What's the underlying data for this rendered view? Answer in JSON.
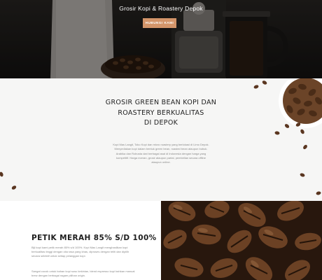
{
  "hero": {
    "title": "Grosir Kopi & Roastery Depok",
    "button_label": "HUBUNGI KAMI"
  },
  "intro": {
    "heading_lines": [
      "GROSIR GREEN BEAN KOPI DAN",
      "ROASTERY BERKUALITAS",
      "DI DEPOK"
    ],
    "body": "Kopi Mas Langit, Toko Kopi dan micro roastery yang berlokasi di Limo Depok. Menyediakan kopi dalam bentuk green bean, roasted bean ataupun bubuk. Arabika dan Robusta dari berbagai asal di Indonesia dengan harga yang kompetitif. Harga eceran, grosir ataupun partai, pembelian secara offline ataupun online."
  },
  "product": {
    "title": "PETIK MERAH 85% S/D 100%",
    "paragraph1": "Biji kopi kami petik merah 85% s/d 100%. Kopi Mas Langit menghasilkan kopi berkualitas tinggi dengan cita rasa yang khas, diproses dengan teliti dan dipilih secara selektif untuk setiap pelanggan kopi.",
    "paragraph2": "Sangat cocok untuk bahan kopi susu kekinian, blend espresso kopi bahkan manual brew dengan berbagai ragam pilihan origin."
  },
  "colors": {
    "accent": "#d4956a",
    "heading": "#1e1e1e",
    "body_text": "#8a8a8a",
    "intro_bg": "#f6f6f5",
    "hero_bg": "#1d1b19"
  }
}
